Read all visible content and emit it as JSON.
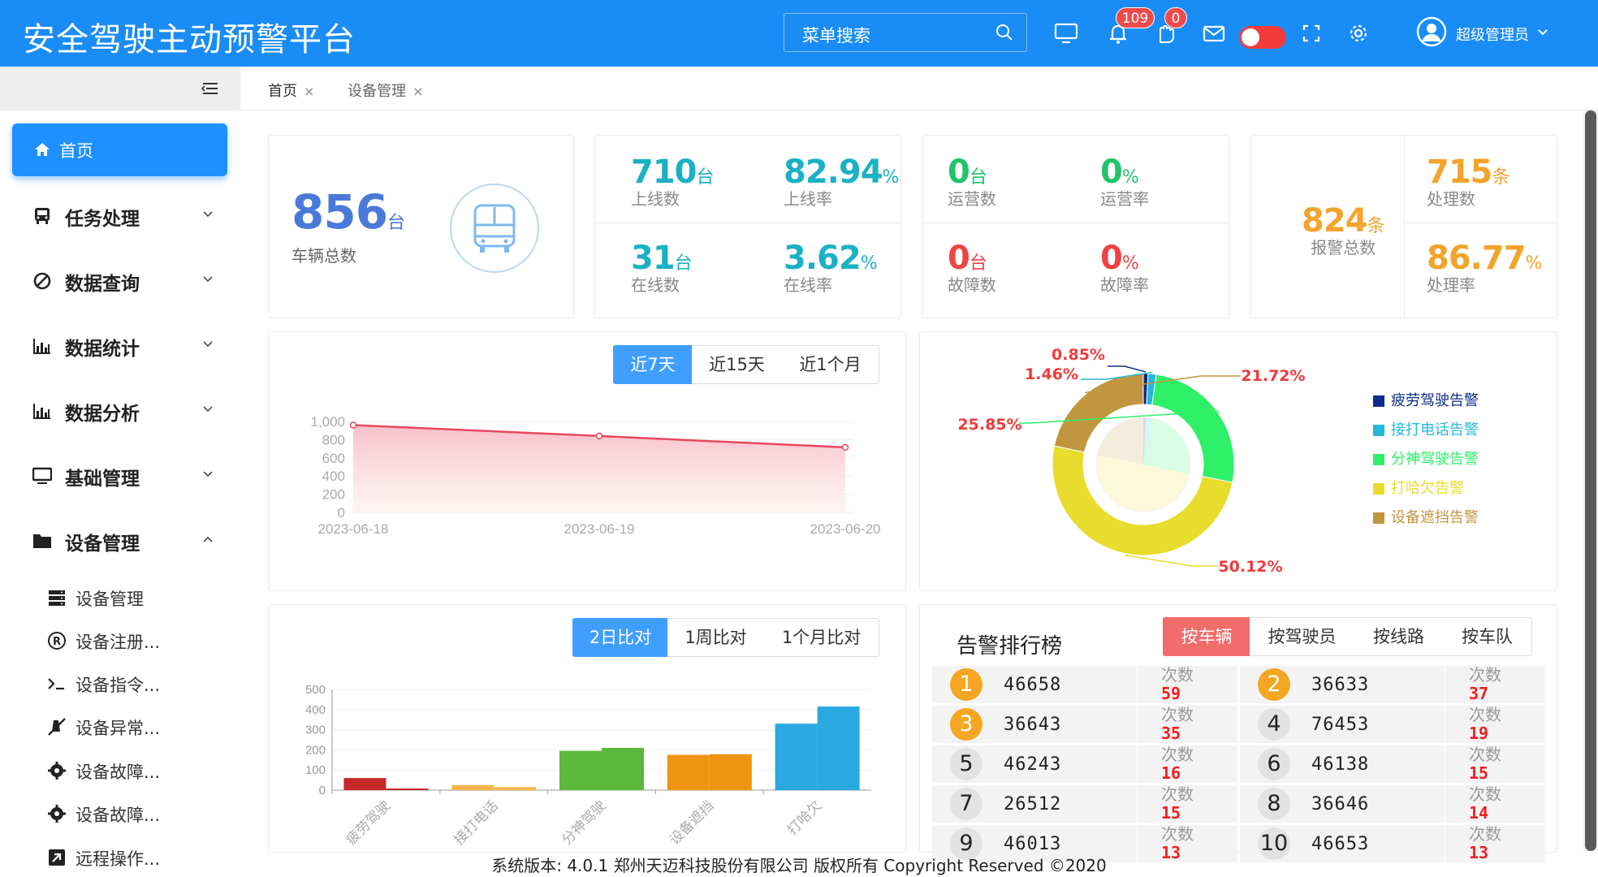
{
  "header": {
    "title": "安全驾驶主动预警平台",
    "search_placeholder": "菜单搜索",
    "bell_badge": "109",
    "hand_badge": "0",
    "user_name": "超级管理员",
    "bg_color": "#1a8cf5"
  },
  "tabs": [
    {
      "label": "首页",
      "close": "×"
    },
    {
      "label": "设备管理",
      "close": "×"
    }
  ],
  "sidebar": {
    "home": "首页",
    "menus": [
      {
        "label": "任务处理",
        "icon": "bus-icon"
      },
      {
        "label": "数据查询",
        "icon": "block-icon"
      },
      {
        "label": "数据统计",
        "icon": "bar-chart-icon"
      },
      {
        "label": "数据分析",
        "icon": "bar-chart-icon"
      },
      {
        "label": "基础管理",
        "icon": "monitor-icon"
      },
      {
        "label": "设备管理",
        "icon": "folder-icon"
      }
    ],
    "sub_items": [
      {
        "label": "设备管理",
        "icon": "server-icon"
      },
      {
        "label": "设备注册...",
        "icon": "registered-icon"
      },
      {
        "label": "设备指令...",
        "icon": "terminal-icon"
      },
      {
        "label": "设备异常...",
        "icon": "mute-icon"
      },
      {
        "label": "设备故障...",
        "icon": "gear-icon"
      },
      {
        "label": "设备故障...",
        "icon": "gear-icon"
      },
      {
        "label": "远程操作...",
        "icon": "external-icon"
      }
    ]
  },
  "stats": {
    "total": {
      "value": "856",
      "unit": "台",
      "label": "车辆总数"
    },
    "online": [
      {
        "value": "710",
        "unit": "台",
        "label": "上线数"
      },
      {
        "value": "82.94",
        "unit": "%",
        "label": "上线率"
      },
      {
        "value": "31",
        "unit": "台",
        "label": "在线数"
      },
      {
        "value": "3.62",
        "unit": "%",
        "label": "在线率"
      }
    ],
    "operation": [
      {
        "value": "0",
        "unit": "台",
        "label": "运营数"
      },
      {
        "value": "0",
        "unit": "%",
        "label": "运营率"
      },
      {
        "value": "0",
        "unit": "台",
        "label": "故障数"
      },
      {
        "value": "0",
        "unit": "%",
        "label": "故障率"
      }
    ],
    "alarm_total": {
      "value": "824",
      "unit": "条",
      "label": "报警总数"
    },
    "handled": [
      {
        "value": "715",
        "unit": "条",
        "label": "处理数"
      },
      {
        "value": "86.77",
        "unit": "%",
        "label": "处理率"
      }
    ]
  },
  "line_controls": [
    "近7天",
    "近15天",
    "近1个月"
  ],
  "bar_controls": [
    "2日比对",
    "1周比对",
    "1个月比对"
  ],
  "rank": {
    "title": "告警排行榜",
    "controls": [
      "按车辆",
      "按驾驶员",
      "按线路",
      "按车队"
    ],
    "times_label": "次数",
    "rows": [
      {
        "rank": "1",
        "plate": "46658",
        "times": "59"
      },
      {
        "rank": "2",
        "plate": "36633",
        "times": "37"
      },
      {
        "rank": "3",
        "plate": "36643",
        "times": "35"
      },
      {
        "rank": "4",
        "plate": "76453",
        "times": "19"
      },
      {
        "rank": "5",
        "plate": "46243",
        "times": "16"
      },
      {
        "rank": "6",
        "plate": "46138",
        "times": "15"
      },
      {
        "rank": "7",
        "plate": "26512",
        "times": "15"
      },
      {
        "rank": "8",
        "plate": "36646",
        "times": "14"
      },
      {
        "rank": "9",
        "plate": "46013",
        "times": "13"
      },
      {
        "rank": "10",
        "plate": "46653",
        "times": "13"
      }
    ]
  },
  "footer": "系统版本: 4.0.1 郑州天迈科技股份有限公司 版权所有 Copyright Reserved ©2020",
  "chart_data": [
    {
      "type": "area",
      "x": [
        "2023-06-18",
        "2023-06-19",
        "2023-06-20"
      ],
      "values": [
        960,
        840,
        715
      ],
      "ylim": [
        0,
        1000
      ],
      "yticks": [
        "0",
        "200",
        "400",
        "600",
        "800",
        "1,000"
      ],
      "color": "#e8485f",
      "grid": true
    },
    {
      "type": "pie",
      "labels": [
        "疲劳驾驶告警",
        "接打电话告警",
        "分神驾驶告警",
        "打哈欠告警",
        "设备遮挡告警"
      ],
      "values": [
        0.85,
        1.46,
        25.85,
        50.12,
        21.72
      ],
      "value_labels": [
        "0.85%",
        "1.46%",
        "25.85%",
        "50.12%",
        "21.72%"
      ],
      "colors": [
        "#0e2a8a",
        "#25b8dc",
        "#2ef068",
        "#e8dc2c",
        "#c0973e"
      ],
      "legend": "right"
    },
    {
      "type": "bar",
      "categories": [
        "疲劳驾驶",
        "接打电话",
        "分神驾驶",
        "设备遮挡",
        "打哈欠"
      ],
      "series": [
        {
          "values": [
            60,
            25,
            195,
            175,
            330
          ]
        },
        {
          "values": [
            8,
            15,
            210,
            178,
            415
          ]
        }
      ],
      "colors": [
        "#c62828",
        "#f5b34d",
        "#5cb83c",
        "#f0930f",
        "#2aa8e0"
      ],
      "ylim": [
        0,
        500
      ],
      "yticks": [
        "0",
        "100",
        "200",
        "300",
        "400",
        "500"
      ],
      "grid": true
    }
  ]
}
